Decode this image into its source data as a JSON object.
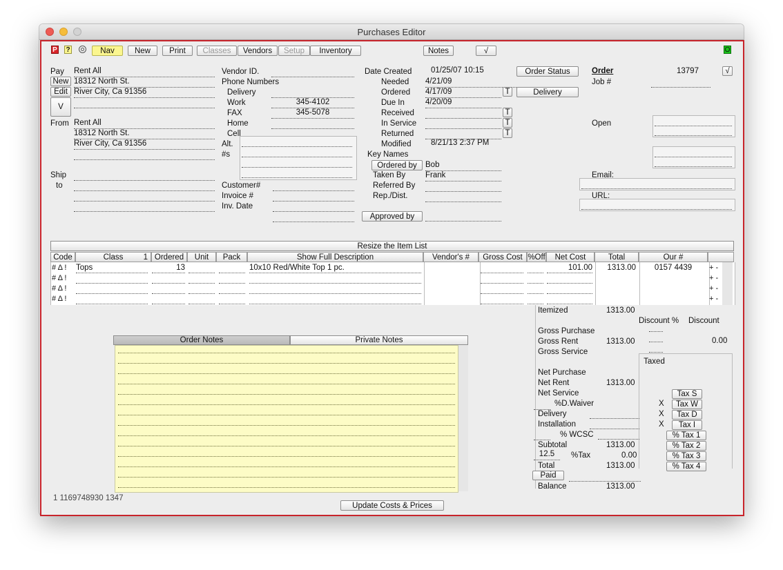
{
  "window": {
    "title": "Purchases Editor"
  },
  "toolbar": {
    "p": "P",
    "q": "?",
    "nav": "Nav",
    "new": "New",
    "print": "Print",
    "classes": "Classes",
    "vendors": "Vendors",
    "setup": "Setup",
    "inventory": "Inventory",
    "notes": "Notes",
    "check": "√",
    "o": "O"
  },
  "pay": {
    "label": "Pay",
    "new": "New",
    "edit": "Edit",
    "v": "V",
    "lines": [
      "Rent All",
      "18312 North St.",
      "River City, Ca 91356",
      ""
    ]
  },
  "from": {
    "label": "From",
    "lines": [
      "Rent All",
      "18312 North St.",
      "River City, Ca 91356",
      ""
    ]
  },
  "ship": {
    "label1": "Ship",
    "label2": "to"
  },
  "vendor": {
    "id_label": "Vendor ID.",
    "id": "",
    "phone_label": "Phone Numbers",
    "delivery_label": "Delivery",
    "delivery": "",
    "work_label": "Work",
    "work": "345-4102",
    "fax_label": "FAX",
    "fax": "345-5078",
    "home_label": "Home",
    "home": "",
    "cell_label": "Cell",
    "cell": "",
    "alt_label": "Alt.",
    "alt_label2": "#s"
  },
  "customer": {
    "customer_label": "Customer#",
    "invoice_label": "Invoice #",
    "invdate_label": "Inv. Date"
  },
  "dates": {
    "created_label": "Date Created",
    "created": "01/25/07 10:15",
    "needed_label": "Needed",
    "needed": "4/21/09",
    "ordered_label": "Ordered",
    "ordered": "4/17/09",
    "duein_label": "Due In",
    "duein": "4/20/09",
    "received_label": "Received",
    "inservice_label": "In Service",
    "returned_label": "Returned",
    "modified_label": "Modified",
    "modified": "8/21/13 2:37 PM",
    "t": "T"
  },
  "buttons": {
    "order_status": "Order Status",
    "delivery": "Delivery",
    "approved_by": "Approved by",
    "ordered_by": "Ordered by"
  },
  "keynames": {
    "label": "Key Names",
    "ordered_by": "Bob",
    "taken_label": "Taken By",
    "taken": "Frank",
    "referred_label": "Referred By",
    "rep_label": "Rep./Dist."
  },
  "order": {
    "label": "Order",
    "number": "13797",
    "check": "√",
    "job_label": "Job #",
    "open_label": "Open",
    "email_label": "Email:",
    "url_label": "URL:"
  },
  "items": {
    "resize_label": "Resize the Item List",
    "headers": {
      "code": "Code",
      "class": "Class",
      "class_num": "1",
      "ordered": "Ordered",
      "unit": "Unit",
      "pack": "Pack",
      "desc": "Show Full Description",
      "vendor": "Vendor's #",
      "gross": "Gross Cost",
      "off": "%Off",
      "net": "Net Cost",
      "total": "Total",
      "our": "Our #"
    },
    "row_symbols": "# Δ !",
    "rows": [
      {
        "class": "Tops",
        "ordered": "13",
        "desc": "10x10 Red/White Top 1 pc.",
        "net": "101.00",
        "total": "1313.00",
        "our": "0157 4439"
      }
    ]
  },
  "tabs": {
    "order_notes": "Order Notes",
    "private_notes": "Private Notes"
  },
  "footer": {
    "id_text": "1 1169748930 1347",
    "update_button": "Update Costs & Prices"
  },
  "totals": {
    "itemized_label": "Itemized",
    "itemized": "1313.00",
    "discount_pct_label": "Discount %",
    "discount_label": "Discount",
    "gross_purchase_label": "Gross Purchase",
    "gross_rent_label": "Gross Rent",
    "gross_rent": "1313.00",
    "gross_rent_discount": "0.00",
    "gross_service_label": "Gross Service",
    "taxed_label": "Taxed",
    "net_purchase_label": "Net Purchase",
    "net_rent_label": "Net Rent",
    "net_rent": "1313.00",
    "net_service_label": "Net Service",
    "dwaiver_label": "%D.Waiver",
    "delivery_label": "Delivery",
    "installation_label": "Installation",
    "wcsc_label": "% WCSC",
    "subtotal_label": "Subtotal",
    "subtotal": "1313.00",
    "tax_rate": "12.5",
    "tax_label": "%Tax",
    "tax": "0.00",
    "total_label": "Total",
    "total": "1313.00",
    "paid_label": "Paid",
    "balance_label": "Balance",
    "balance": "1313.00",
    "x": "X",
    "tax_buttons": [
      "Tax S",
      "Tax W",
      "Tax D",
      "Tax I",
      "% Tax 1",
      "% Tax 2",
      "% Tax 3",
      "% Tax 4"
    ]
  },
  "colors": {
    "frame_red": "#c8242b",
    "nav_yellow": "#fbf68f",
    "notes_yellow": "#fdfcc6",
    "o_green": "#19c21a"
  }
}
